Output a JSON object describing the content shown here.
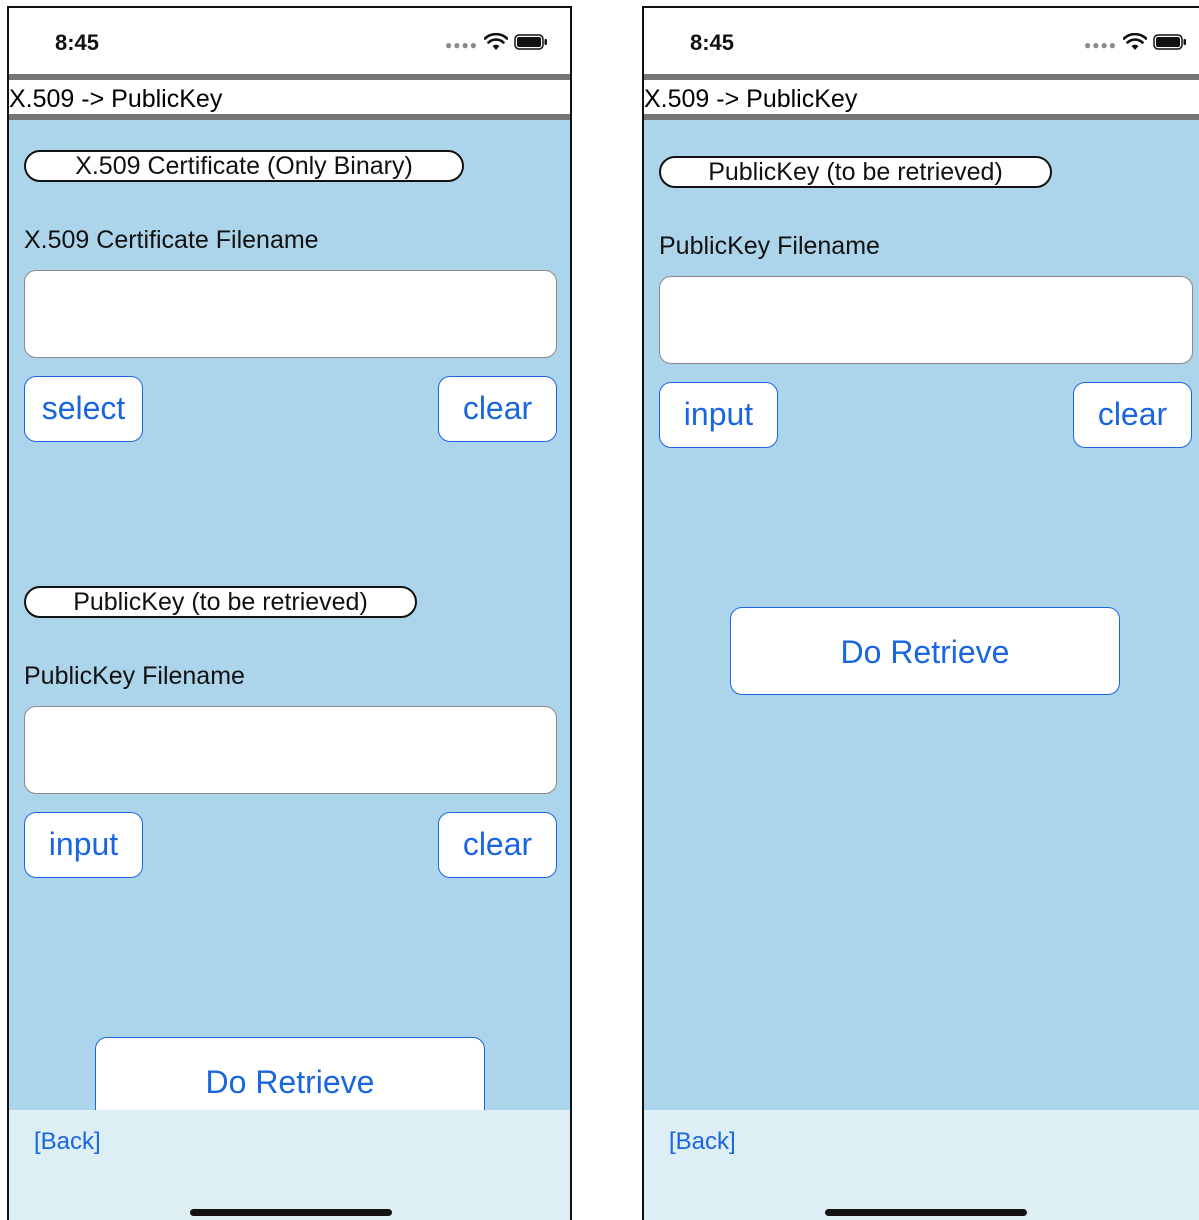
{
  "status_bar": {
    "time": "8:45"
  },
  "nav": {
    "title": "X.509 -> PublicKey",
    "back_label": "[Back]"
  },
  "left_screen": {
    "certificate_section": {
      "pill_label": "X.509 Certificate (Only Binary)",
      "field_label": "X.509 Certificate Filename",
      "field_value": "",
      "select_label": "select",
      "clear_label": "clear"
    },
    "publickey_section": {
      "pill_label": "PublicKey (to be retrieved)",
      "field_label": "PublicKey Filename",
      "field_value": "",
      "input_label": "input",
      "clear_label": "clear"
    },
    "action_label": "Do Retrieve"
  },
  "right_screen": {
    "publickey_section": {
      "pill_label": "PublicKey (to be retrieved)",
      "field_label": "PublicKey Filename",
      "field_value": "",
      "input_label": "input",
      "clear_label": "clear"
    },
    "action_label": "Do Retrieve"
  },
  "colors": {
    "background": "#acd4ea",
    "accent": "#1a66e0",
    "bottom_bar": "#ddeef5"
  }
}
